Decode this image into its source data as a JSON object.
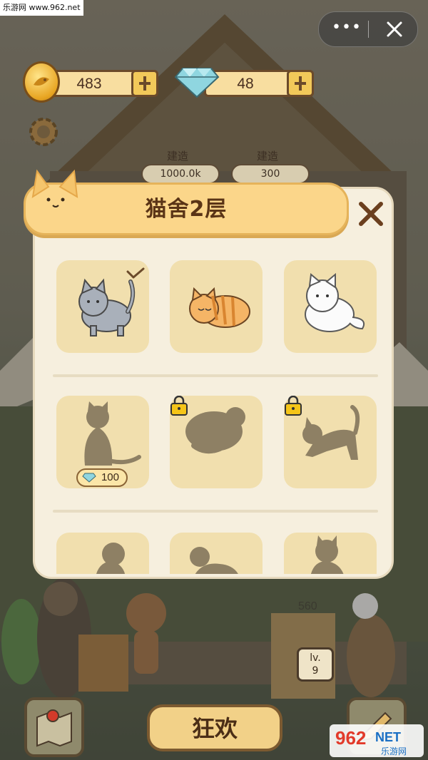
{
  "watermark": "乐游网 www.962.net",
  "capsule": {
    "more_icon": "more-dots-icon",
    "close_icon": "close-icon"
  },
  "currency": {
    "coins": {
      "value": "483",
      "icon": "fish-coin-icon"
    },
    "gems": {
      "value": "48",
      "icon": "diamond-icon"
    }
  },
  "background": {
    "build_label_1": "建造",
    "build_label_2": "建造",
    "build_cost_1": "1000.0k",
    "build_cost_2": "300",
    "score": "560",
    "level": "lv.\n9"
  },
  "panel": {
    "title": "猫舍2层",
    "rows": [
      {
        "cells": [
          {
            "name": "gray-cat",
            "state": "selected"
          },
          {
            "name": "orange-tabby-cat",
            "state": "owned"
          },
          {
            "name": "white-fluffy-cat",
            "state": "owned"
          }
        ]
      },
      {
        "cells": [
          {
            "name": "sitting-cat-silhouette",
            "state": "price",
            "price": "100"
          },
          {
            "name": "curled-cat-silhouette",
            "state": "locked"
          },
          {
            "name": "stretching-cat-silhouette",
            "state": "locked"
          }
        ]
      },
      {
        "cells": [
          {
            "name": "cat-silhouette-a",
            "state": "locked"
          },
          {
            "name": "cat-silhouette-b",
            "state": "locked"
          },
          {
            "name": "cat-silhouette-c",
            "state": "locked"
          }
        ]
      }
    ]
  },
  "bottom": {
    "party_button": "狂欢"
  },
  "logo": {
    "text_1": "962",
    "text_2": "NET",
    "text_3": "乐游网"
  },
  "colors": {
    "panel_bg": "#f6efde",
    "cell_bg": "#f1dfae",
    "banner": "#fbd68a",
    "title": "#5a3416",
    "silhouette": "#8e8064",
    "lock": "#f5c518"
  }
}
